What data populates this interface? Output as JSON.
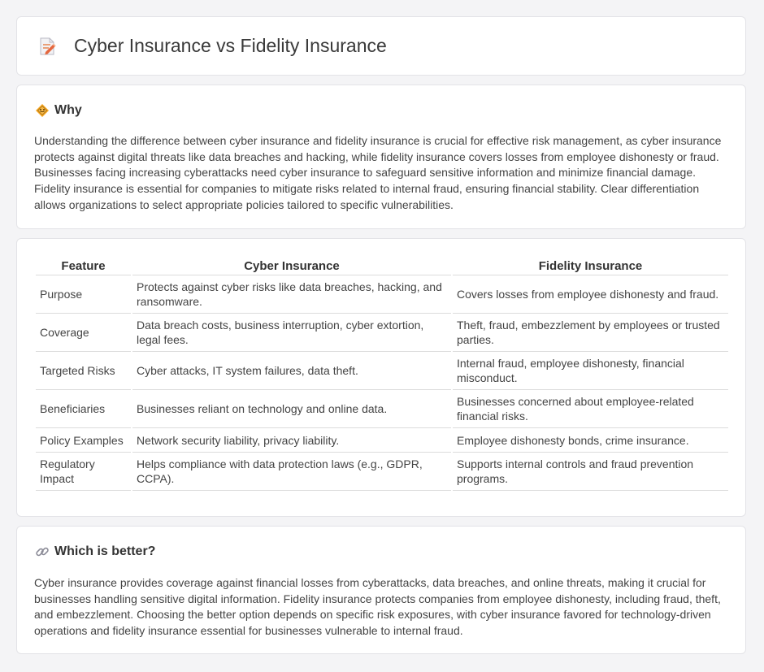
{
  "page": {
    "title": "Cyber Insurance vs Fidelity Insurance",
    "title_icon": "document-pencil-icon"
  },
  "why": {
    "heading": "Why",
    "icon": "diamond-sign-icon",
    "text": "Understanding the difference between cyber insurance and fidelity insurance is crucial for effective risk management, as cyber insurance protects against digital threats like data breaches and hacking, while fidelity insurance covers losses from employee dishonesty or fraud. Businesses facing increasing cyberattacks need cyber insurance to safeguard sensitive information and minimize financial damage. Fidelity insurance is essential for companies to mitigate risks related to internal fraud, ensuring financial stability. Clear differentiation allows organizations to select appropriate policies tailored to specific vulnerabilities."
  },
  "table": {
    "headers": [
      "Feature",
      "Cyber Insurance",
      "Fidelity Insurance"
    ],
    "rows": [
      [
        "Purpose",
        "Protects against cyber risks like data breaches, hacking, and ransomware.",
        "Covers losses from employee dishonesty and fraud."
      ],
      [
        "Coverage",
        "Data breach costs, business interruption, cyber extortion, legal fees.",
        "Theft, fraud, embezzlement by employees or trusted parties."
      ],
      [
        "Targeted Risks",
        "Cyber attacks, IT system failures, data theft.",
        "Internal fraud, employee dishonesty, financial misconduct."
      ],
      [
        "Beneficiaries",
        "Businesses reliant on technology and online data.",
        "Businesses concerned about employee-related financial risks."
      ],
      [
        "Policy Examples",
        "Network security liability, privacy liability.",
        "Employee dishonesty bonds, crime insurance."
      ],
      [
        "Regulatory Impact",
        "Helps compliance with data protection laws (e.g., GDPR, CCPA).",
        "Supports internal controls and fraud prevention programs."
      ]
    ]
  },
  "better": {
    "heading": "Which is better?",
    "icon": "link-icon",
    "text": "Cyber insurance provides coverage against financial losses from cyberattacks, data breaches, and online threats, making it crucial for businesses handling sensitive digital information. Fidelity insurance protects companies from employee dishonesty, including fraud, theft, and embezzlement. Choosing the better option depends on specific risk exposures, with cyber insurance favored for technology-driven operations and fidelity insurance essential for businesses vulnerable to internal fraud."
  }
}
